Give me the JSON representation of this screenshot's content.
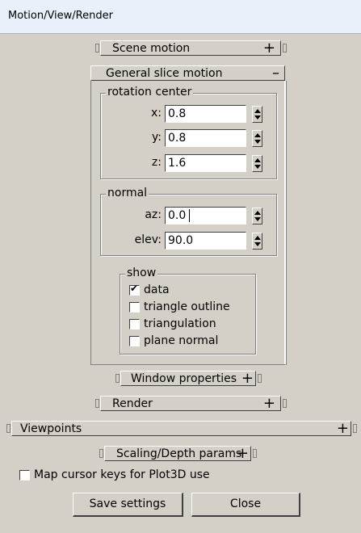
{
  "window": {
    "title": "Motion/View/Render"
  },
  "rollouts": {
    "scene_motion": {
      "label": "Scene motion",
      "sign": "+"
    },
    "general_slice_motion": {
      "label": "General slice motion",
      "sign": "–"
    },
    "window_properties": {
      "label": "Window properties",
      "sign": "+"
    },
    "render": {
      "label": "Render",
      "sign": "+"
    },
    "viewpoints": {
      "label": "Viewpoints",
      "sign": "+"
    },
    "scaling_depth": {
      "label": "Scaling/Depth params",
      "sign": "+"
    }
  },
  "rotation_center": {
    "title": "rotation center",
    "x": {
      "label": "x:",
      "value": "0.8"
    },
    "y": {
      "label": "y:",
      "value": "0.8"
    },
    "z": {
      "label": "z:",
      "value": "1.6"
    }
  },
  "normal": {
    "title": "normal",
    "az": {
      "label": "az:",
      "value": "0.0"
    },
    "elev": {
      "label": "elev:",
      "value": "90.0"
    }
  },
  "show": {
    "title": "show",
    "items": [
      {
        "label": "data",
        "checked": true
      },
      {
        "label": "triangle outline",
        "checked": false
      },
      {
        "label": "triangulation",
        "checked": false
      },
      {
        "label": "plane normal",
        "checked": false
      }
    ]
  },
  "map_cursor": {
    "label": "Map cursor keys for Plot3D use",
    "checked": false
  },
  "buttons": {
    "save": "Save settings",
    "close": "Close"
  }
}
